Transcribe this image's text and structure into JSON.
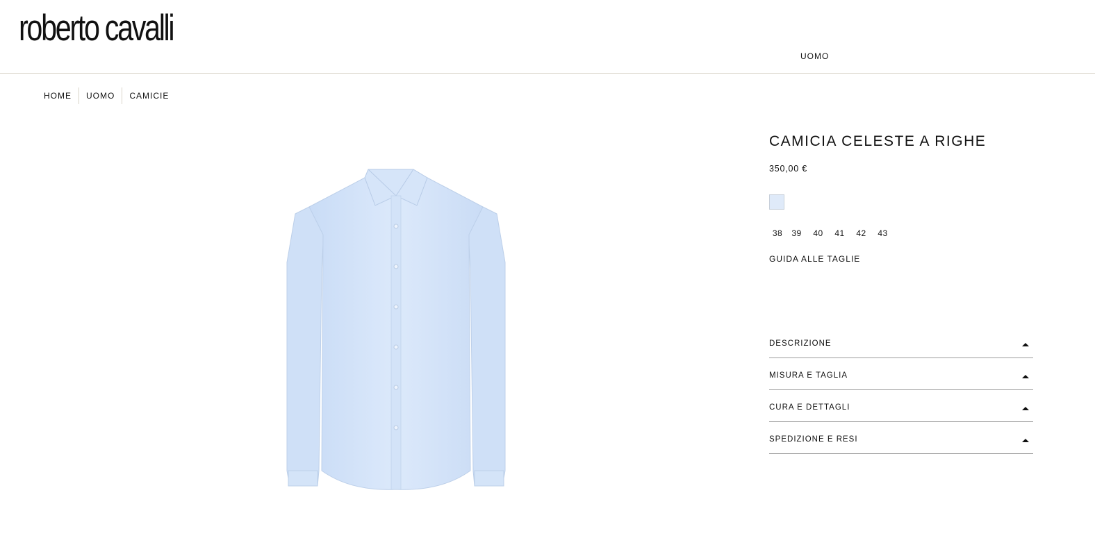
{
  "header": {
    "logo": "roberto cavalli",
    "nav": {
      "uomo": "UOMO"
    }
  },
  "breadcrumb": [
    "HOME",
    "UOMO",
    "CAMICIE"
  ],
  "product": {
    "title": "CAMICIA CELESTE A RIGHE",
    "price": "350,00 €",
    "swatch_color": "#dfeaf9",
    "sizes": [
      "38",
      "39",
      "40",
      "41",
      "42",
      "43"
    ],
    "size_guide": "GUIDA ALLE TAGLIE",
    "accordion": [
      "DESCRIZIONE",
      "MISURA E TAGLIA",
      "CURA E DETTAGLI",
      "SPEDIZIONE E RESI"
    ]
  },
  "icons": {
    "accordion_toggle": "triangle-up-icon"
  }
}
